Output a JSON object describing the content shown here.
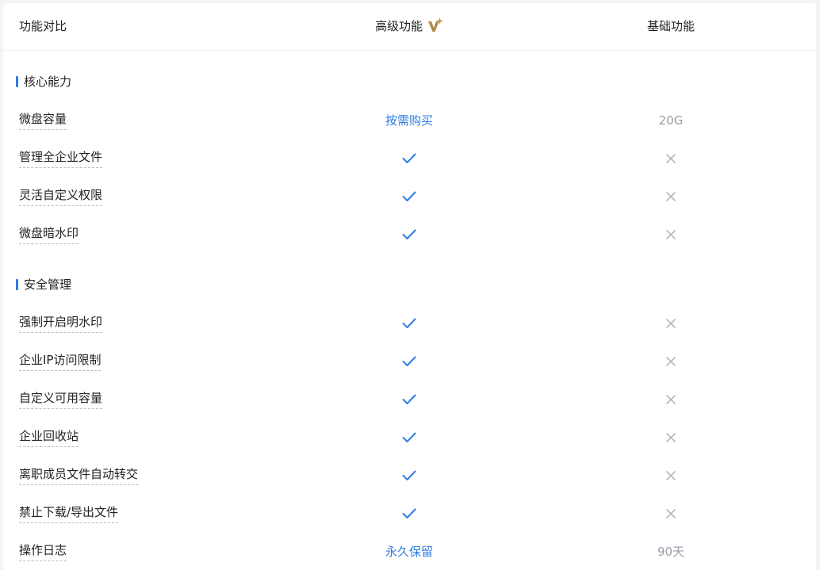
{
  "header": {
    "feature_col": "功能对比",
    "advanced_col": "高级功能",
    "basic_col": "基础功能",
    "vip_icon": "vip-sparkle-icon"
  },
  "colors": {
    "accent_blue": "#2f7de1",
    "cross_grey": "#b5b9bf",
    "vip_gold": "#b08a4a"
  },
  "sections": [
    {
      "title": "核心能力",
      "rows": [
        {
          "name": "微盘容量",
          "advanced": "按需购买",
          "basic": "20G"
        },
        {
          "name": "管理全企业文件",
          "advanced": "check",
          "basic": "cross"
        },
        {
          "name": "灵活自定义权限",
          "advanced": "check",
          "basic": "cross"
        },
        {
          "name": "微盘暗水印",
          "advanced": "check",
          "basic": "cross"
        }
      ]
    },
    {
      "title": "安全管理",
      "rows": [
        {
          "name": "强制开启明水印",
          "advanced": "check",
          "basic": "cross"
        },
        {
          "name": "企业IP访问限制",
          "advanced": "check",
          "basic": "cross"
        },
        {
          "name": "自定义可用容量",
          "advanced": "check",
          "basic": "cross"
        },
        {
          "name": "企业回收站",
          "advanced": "check",
          "basic": "cross"
        },
        {
          "name": "离职成员文件自动转交",
          "advanced": "check",
          "basic": "cross"
        },
        {
          "name": "禁止下载/导出文件",
          "advanced": "check",
          "basic": "cross"
        },
        {
          "name": "操作日志",
          "advanced": "永久保留",
          "basic": "90天"
        }
      ]
    }
  ]
}
